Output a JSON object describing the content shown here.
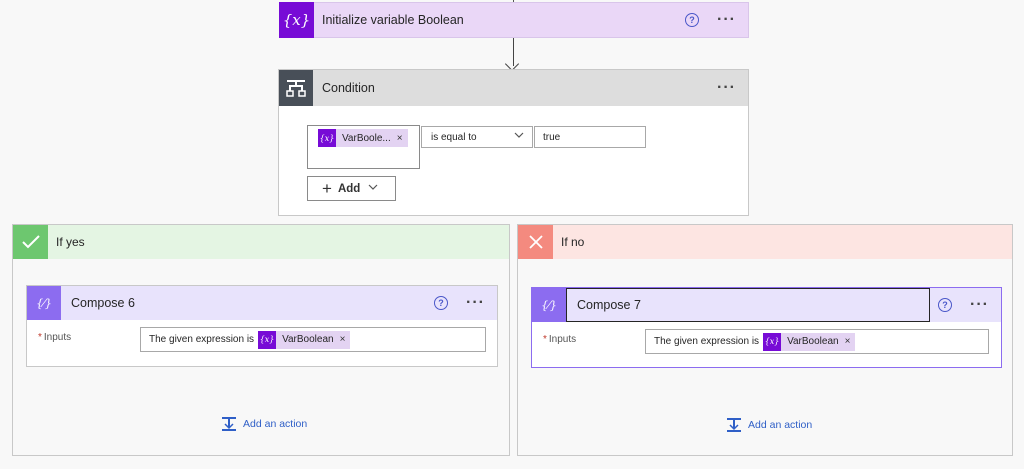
{
  "init_variable": {
    "title": "Initialize variable Boolean",
    "icon": "variable-icon"
  },
  "condition": {
    "title": "Condition",
    "token_label": "VarBoole...",
    "operator": "is equal to",
    "value": "true",
    "add_label": "Add"
  },
  "branch_yes": {
    "title": "If yes",
    "compose": {
      "title": "Compose 6",
      "inputs_label": "Inputs",
      "inputs_prefix": "The given expression is",
      "token_label": "VarBoolean"
    },
    "add_action_label": "Add an action"
  },
  "branch_no": {
    "title": "If no",
    "compose": {
      "title": "Compose 7",
      "inputs_label": "Inputs",
      "inputs_prefix": "The given expression is",
      "token_label": "VarBoolean"
    },
    "add_action_label": "Add an action"
  },
  "symbols": {
    "required": "*",
    "remove": "×",
    "more": "···",
    "help": "?",
    "variable": "{x}"
  },
  "colors": {
    "variable_purple": "#770bd6",
    "compose_purple": "#8c6cf0",
    "yes_green": "#6dc76f",
    "no_red": "#f48a7f",
    "link_blue": "#2f5fc7"
  }
}
